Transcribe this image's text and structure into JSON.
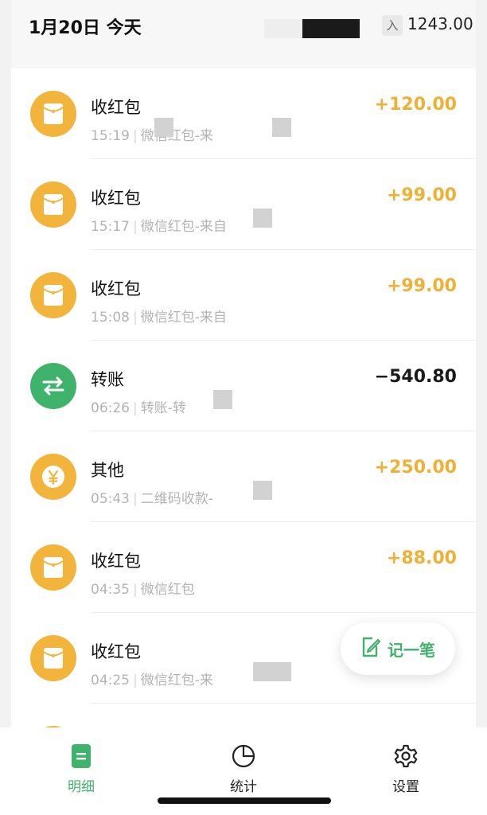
{
  "header": {
    "date_label": "1月20日 今天",
    "income_badge": "入",
    "income_total": "1243.00"
  },
  "transactions": [
    {
      "title": "收红包",
      "time": "15:19",
      "desc": "微信红包-来",
      "amount": "+120.00",
      "kind": "red-packet"
    },
    {
      "title": "收红包",
      "time": "15:17",
      "desc": "微信红包-来自",
      "amount": "+99.00",
      "kind": "red-packet"
    },
    {
      "title": "收红包",
      "time": "15:08",
      "desc": "微信红包-来自",
      "amount": "+99.00",
      "kind": "red-packet"
    },
    {
      "title": "转账",
      "time": "06:26",
      "desc": "转账-转",
      "amount": "−540.80",
      "kind": "transfer"
    },
    {
      "title": "其他",
      "time": "05:43",
      "desc": "二维码收款-",
      "amount": "+250.00",
      "kind": "other"
    },
    {
      "title": "收红包",
      "time": "04:35",
      "desc": "微信红包",
      "amount": "+88.00",
      "kind": "red-packet"
    },
    {
      "title": "收红包",
      "time": "04:25",
      "desc": "微信红包-来",
      "amount": "",
      "kind": "red-packet"
    }
  ],
  "fab": {
    "label": "记一笔",
    "icon": "edit-note-icon"
  },
  "tabs": [
    {
      "label": "明细",
      "icon": "document-icon",
      "active": true
    },
    {
      "label": "统计",
      "icon": "pie-chart-icon",
      "active": false
    },
    {
      "label": "设置",
      "icon": "gear-icon",
      "active": false
    }
  ],
  "colors": {
    "accent_green": "#3fb26b",
    "income_gold": "#efb035",
    "red_packet_icon": "#f2b43a"
  }
}
